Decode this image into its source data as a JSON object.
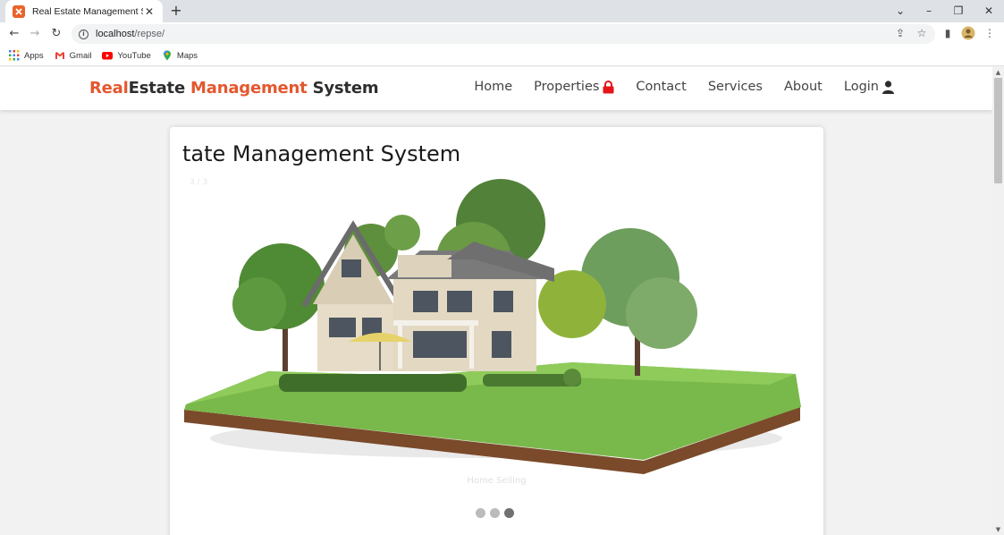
{
  "browser": {
    "tab_title": "Real Estate Management System",
    "url_host": "localhost",
    "url_path": "/repse/",
    "bookmarks": [
      {
        "label": "Apps",
        "icon": "apps-grid-icon"
      },
      {
        "label": "Gmail",
        "icon": "gmail-icon"
      },
      {
        "label": "YouTube",
        "icon": "youtube-icon"
      },
      {
        "label": "Maps",
        "icon": "maps-icon"
      }
    ]
  },
  "site": {
    "brand_part1": "Real",
    "brand_part2": "Estate ",
    "brand_part3": "Management",
    "brand_part4": " System",
    "nav": [
      {
        "label": "Home"
      },
      {
        "label": "Properties",
        "icon": "lock-icon"
      },
      {
        "label": "Contact"
      },
      {
        "label": "Services"
      },
      {
        "label": "About"
      },
      {
        "label": "Login",
        "icon": "user-icon"
      }
    ],
    "accent_color": "#e4572e"
  },
  "slider": {
    "heading": "tate Management System",
    "counter": "3 / 3",
    "caption": "Home Selling",
    "dots": [
      {
        "active": false
      },
      {
        "active": false
      },
      {
        "active": true
      }
    ]
  }
}
